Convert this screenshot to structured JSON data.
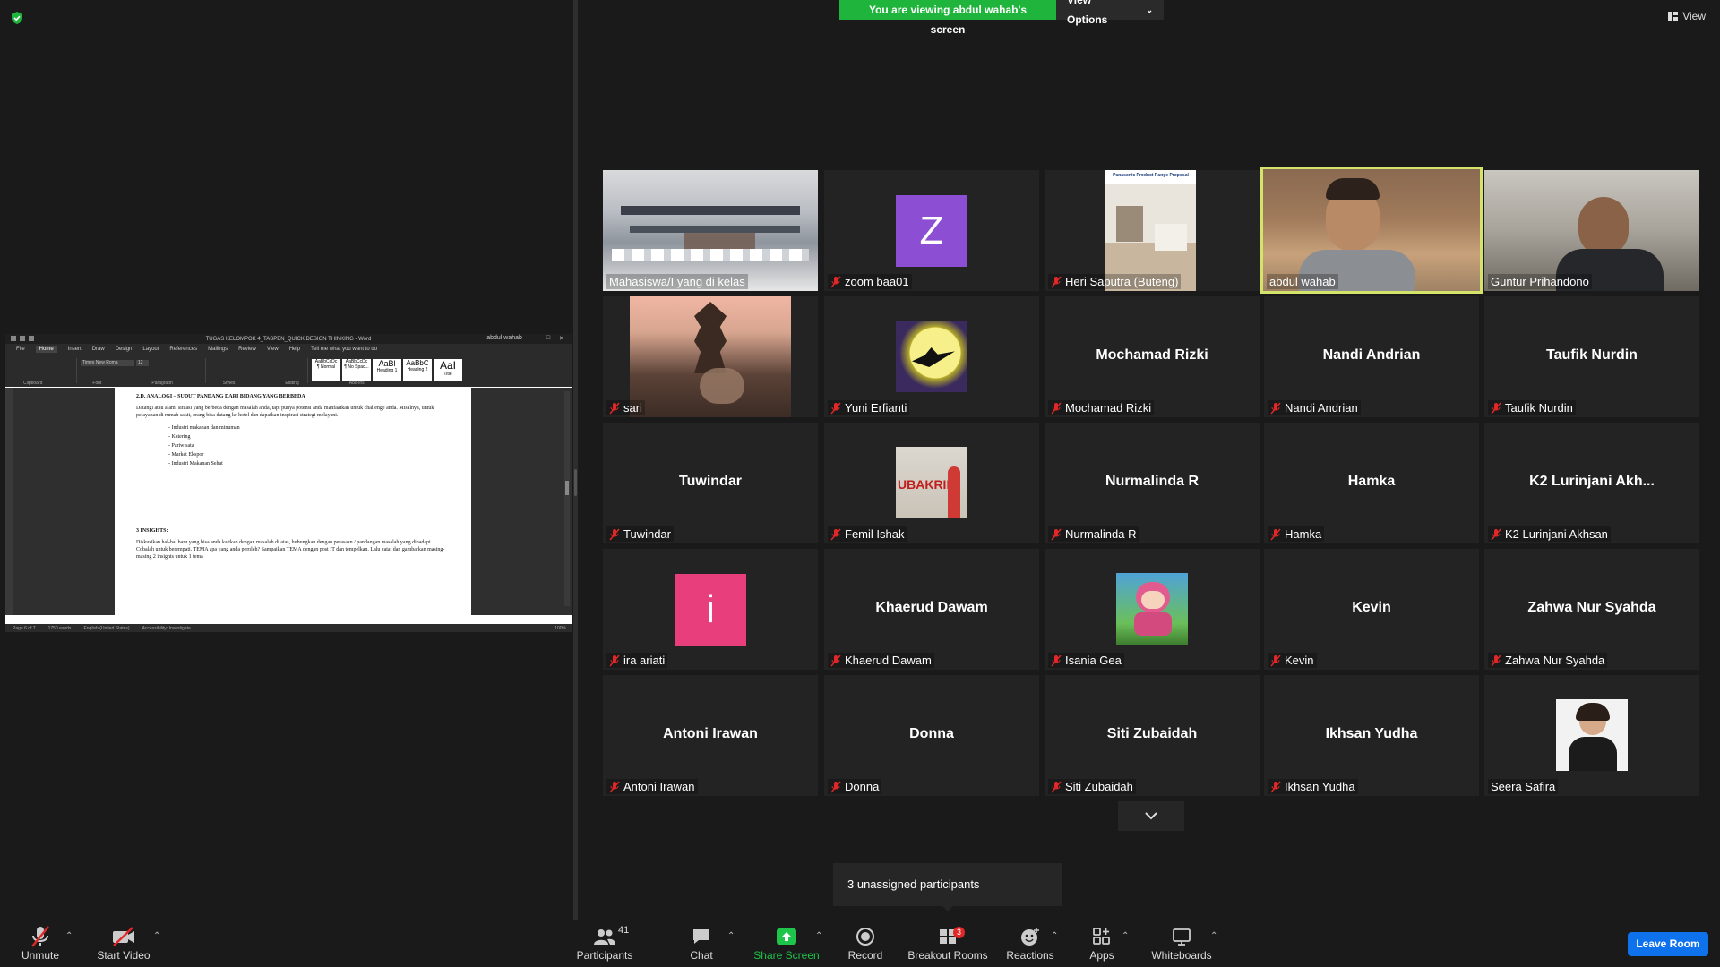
{
  "banner": {
    "viewing_text": "You are viewing abdul wahab's screen",
    "view_options_label": "View Options"
  },
  "top_right": {
    "view_label": "View"
  },
  "word": {
    "title": "TUGAS KELOMPOK 4_TASPEN_QUICK DESIGN THINKING  -  Word",
    "user": "abdul wahab",
    "tabs": [
      "File",
      "Home",
      "Insert",
      "Draw",
      "Design",
      "Layout",
      "References",
      "Mailings",
      "Review",
      "View",
      "Help"
    ],
    "tell_me": "Tell me what you want to do",
    "font_name": "Times New Roma",
    "font_size": "12",
    "styles": [
      "AaBbCcDc",
      "AaBbCcDc",
      "AaBl",
      "AaBbC",
      "AaI"
    ],
    "style_names": [
      "¶ Normal",
      "¶ No Spac...",
      "Heading 1",
      "Heading 2",
      "Title"
    ],
    "groups": [
      "Clipboard",
      "Font",
      "Paragraph",
      "Styles",
      "Editing",
      "Add-ins"
    ],
    "heading1": "2.D. ANALOGI – SUDUT PANDANG DARI BIDANG YANG BERBEDA",
    "para1": "Datangi atau alami situasi yang berbeda dengan masalah anda, tapi punya potensi anda manfaatkan untuk challenge anda. Misalnya, untuk pelayanan di rumah sakit, orang bisa datang ke hotel dan dapatkan inspirasi strategi melayani.",
    "list": [
      "Industri makanan dan minuman",
      "Katering",
      "Pariwisata",
      "Market Ekspor",
      "Industri Makanan Sehat"
    ],
    "heading2": "3 INSIGHTS:",
    "para2": "Diskusikan hal-hal baru yang bisa anda kaitkan dengan masalah di atas, hubungkan dengan perasaan / pandangan masalah yang dihadapi. Cobalah untuk berempati. TEMA apa yang anda peroleh? Sampaikan TEMA dengan post IT dan tempelkan. Lalu catat dan gambarkan masing-masing 2 insights untuk 1 tema",
    "status": [
      "Page 6 of 7",
      "1750 words",
      "English (United States)",
      "Accessibility: Investigate",
      "100%"
    ]
  },
  "participants": [
    {
      "name": "Mahasiswa/I yang di kelas",
      "display": "",
      "muted": false,
      "type": "video"
    },
    {
      "name": "zoom baa01",
      "display": "Z",
      "muted": true,
      "type": "letter",
      "color": "#8c4fd3"
    },
    {
      "name": "Heri Saputra (Buteng)",
      "display": "",
      "muted": true,
      "type": "image"
    },
    {
      "name": "abdul wahab",
      "display": "",
      "muted": false,
      "type": "video"
    },
    {
      "name": "Guntur Prihandono",
      "display": "",
      "muted": false,
      "type": "video"
    },
    {
      "name": "sari",
      "display": "",
      "muted": true,
      "type": "image"
    },
    {
      "name": "Yuni Erfianti",
      "display": "",
      "muted": true,
      "type": "image"
    },
    {
      "name": "Mochamad Rizki",
      "display": "Mochamad Rizki",
      "muted": true,
      "type": "name"
    },
    {
      "name": "Nandi Andrian",
      "display": "Nandi Andrian",
      "muted": true,
      "type": "name"
    },
    {
      "name": "Taufik Nurdin",
      "display": "Taufik Nurdin",
      "muted": true,
      "type": "name"
    },
    {
      "name": "Tuwindar",
      "display": "Tuwindar",
      "muted": true,
      "type": "name"
    },
    {
      "name": "Femil Ishak",
      "display": "",
      "muted": true,
      "type": "image"
    },
    {
      "name": "Nurmalinda R",
      "display": "Nurmalinda R",
      "muted": true,
      "type": "name"
    },
    {
      "name": "Hamka",
      "display": "Hamka",
      "muted": true,
      "type": "name"
    },
    {
      "name": "K2 Lurinjani Akhsan",
      "display": "K2 Lurinjani Akh...",
      "muted": true,
      "type": "name"
    },
    {
      "name": "ira ariati",
      "display": "i",
      "muted": true,
      "type": "letter",
      "color": "#e83e7b"
    },
    {
      "name": "Khaerud Dawam",
      "display": "Khaerud Dawam",
      "muted": true,
      "type": "name"
    },
    {
      "name": "Isania Gea",
      "display": "",
      "muted": true,
      "type": "image"
    },
    {
      "name": "Kevin",
      "display": "Kevin",
      "muted": true,
      "type": "name"
    },
    {
      "name": "Zahwa Nur Syahda",
      "display": "Zahwa Nur Syahda",
      "muted": true,
      "type": "name"
    },
    {
      "name": "Antoni Irawan",
      "display": "Antoni Irawan",
      "muted": true,
      "type": "name"
    },
    {
      "name": "Donna",
      "display": "Donna",
      "muted": true,
      "type": "name"
    },
    {
      "name": "Siti Zubaidah",
      "display": "Siti Zubaidah",
      "muted": true,
      "type": "name"
    },
    {
      "name": "Ikhsan Yudha",
      "display": "Ikhsan Yudha",
      "muted": true,
      "type": "name"
    },
    {
      "name": "Seera Safira",
      "display": "",
      "muted": false,
      "type": "image"
    }
  ],
  "thumb_text": {
    "femil": "UBAKRIE",
    "heri": "Panasonic Product Range Proposal"
  },
  "toast": "3 unassigned participants",
  "toolbar": {
    "unmute": "Unmute",
    "start_video": "Start Video",
    "participants": "Participants",
    "participants_count": "41",
    "chat": "Chat",
    "share": "Share Screen",
    "record": "Record",
    "breakout": "Breakout Rooms",
    "breakout_badge": "3",
    "reactions": "Reactions",
    "apps": "Apps",
    "whiteboards": "Whiteboards",
    "leave": "Leave Room"
  }
}
